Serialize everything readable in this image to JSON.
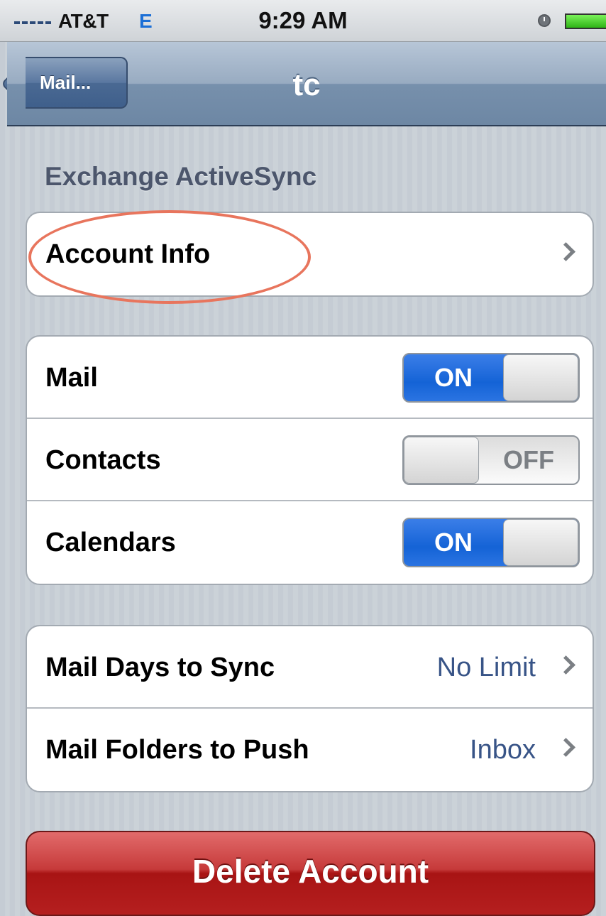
{
  "status_bar": {
    "carrier": "AT&T",
    "network": "E",
    "time": "9:29 AM"
  },
  "nav": {
    "back_label": "Mail...",
    "title": "tc"
  },
  "section_header": "Exchange ActiveSync",
  "account_info": {
    "label": "Account Info"
  },
  "sync_toggles": [
    {
      "label": "Mail",
      "state": "ON"
    },
    {
      "label": "Contacts",
      "state": "OFF"
    },
    {
      "label": "Calendars",
      "state": "ON"
    }
  ],
  "mail_settings": [
    {
      "label": "Mail Days to Sync",
      "value": "No Limit"
    },
    {
      "label": "Mail Folders to Push",
      "value": "Inbox"
    }
  ],
  "delete_button": "Delete Account",
  "colors": {
    "switch_on": "#1463d6",
    "delete_red": "#b51f1f",
    "highlight": "#e8755d",
    "value_blue": "#385487"
  }
}
